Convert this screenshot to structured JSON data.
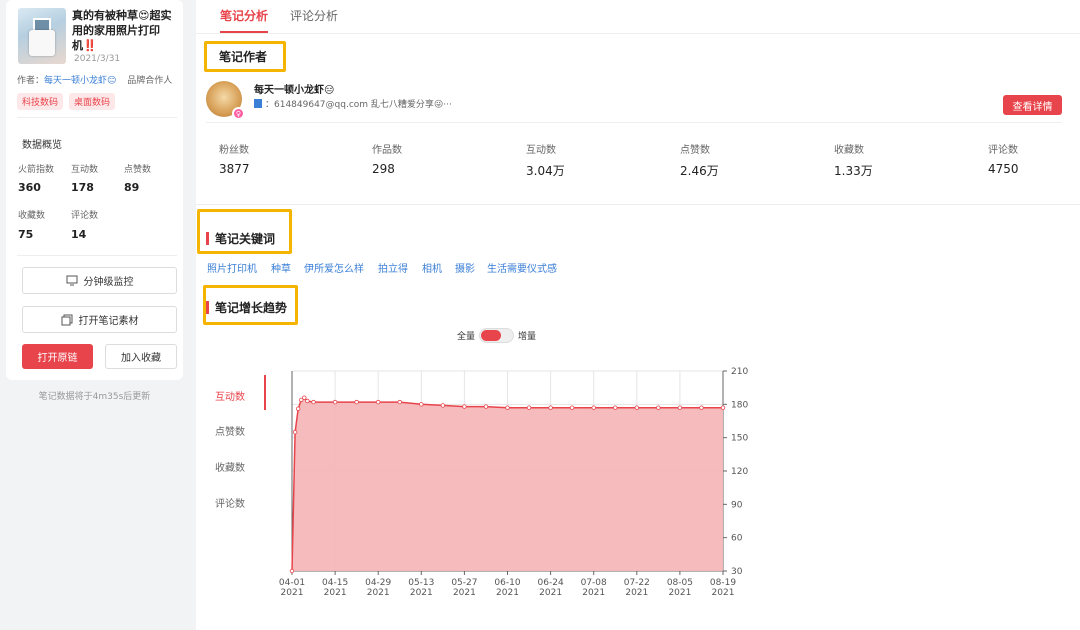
{
  "note": {
    "title": "真的有被种草😍超实用的家用照片打印机‼️",
    "date": "2021/3/31",
    "author_prefix": "作者：",
    "author_name": "每天一顿小龙虾😑",
    "brand_label": "品牌合作人",
    "tags": [
      "科技数码",
      "桌面数码"
    ]
  },
  "overview": {
    "heading": "数据概览",
    "stats": [
      {
        "label": "火箭指数",
        "value": "360"
      },
      {
        "label": "互动数",
        "value": "178"
      },
      {
        "label": "点赞数",
        "value": "89"
      },
      {
        "label": "收藏数",
        "value": "75"
      },
      {
        "label": "评论数",
        "value": "14"
      }
    ]
  },
  "left_buttons": {
    "monitor": "分钟级监控",
    "open_material": "打开笔记素材",
    "open_link": "打开原链",
    "add_fav": "加入收藏"
  },
  "update_note": "笔记数据将于4m35s后更新",
  "tabs": [
    {
      "label": "笔记分析",
      "active": true
    },
    {
      "label": "评论分析",
      "active": false
    }
  ],
  "author_section": {
    "title": "笔记作者",
    "name": "每天一顿小龙虾😑",
    "contact": "：614849647@qq.com 乱七八糟爱分享😜···",
    "detail_button": "查看详情",
    "metrics": [
      {
        "label": "粉丝数",
        "value": "3877"
      },
      {
        "label": "作品数",
        "value": "298"
      },
      {
        "label": "互动数",
        "value": "3.04万"
      },
      {
        "label": "点赞数",
        "value": "2.46万"
      },
      {
        "label": "收藏数",
        "value": "1.33万"
      },
      {
        "label": "评论数",
        "value": "4750"
      }
    ]
  },
  "keyword_section": {
    "title": "笔记关键词",
    "keywords": [
      "照片打印机",
      "种草",
      "伊所爱怎么样",
      "拍立得",
      "相机",
      "摄影",
      "生活需要仪式感"
    ]
  },
  "trend_section": {
    "title": "笔记增长趋势",
    "toggle_left": "全量",
    "toggle_right": "增量",
    "metrics": [
      "互动数",
      "点赞数",
      "收藏数",
      "评论数"
    ],
    "active_metric": "互动数"
  },
  "colors": {
    "accent": "#e8444b",
    "link": "#3b7fd6",
    "highlight": "#f5b400",
    "area_fill": "#f5b7b9"
  },
  "chart_data": {
    "type": "area",
    "x": [
      "04-01",
      "04-02",
      "04-03",
      "04-04",
      "04-05",
      "04-06",
      "04-08",
      "04-15",
      "04-22",
      "04-29",
      "05-06",
      "05-13",
      "05-20",
      "05-27",
      "06-03",
      "06-10",
      "06-17",
      "06-24",
      "07-01",
      "07-08",
      "07-15",
      "07-22",
      "07-29",
      "08-05",
      "08-12",
      "08-19"
    ],
    "values": [
      30,
      155,
      176,
      184,
      186,
      183,
      182,
      182,
      182,
      182,
      182,
      180,
      179,
      178,
      178,
      177,
      177,
      177,
      177,
      177,
      177,
      177,
      177,
      177,
      177,
      177
    ],
    "x_ticks": [
      "04-01",
      "04-15",
      "04-29",
      "05-13",
      "05-27",
      "06-10",
      "06-24",
      "07-08",
      "07-22",
      "08-05",
      "08-19"
    ],
    "x_tick_year": "2021",
    "y_ticks": [
      "30",
      "60",
      "90",
      "120",
      "150",
      "180",
      "210"
    ],
    "ylim": [
      30,
      210
    ],
    "grid": true,
    "y_axis_side": "right"
  }
}
